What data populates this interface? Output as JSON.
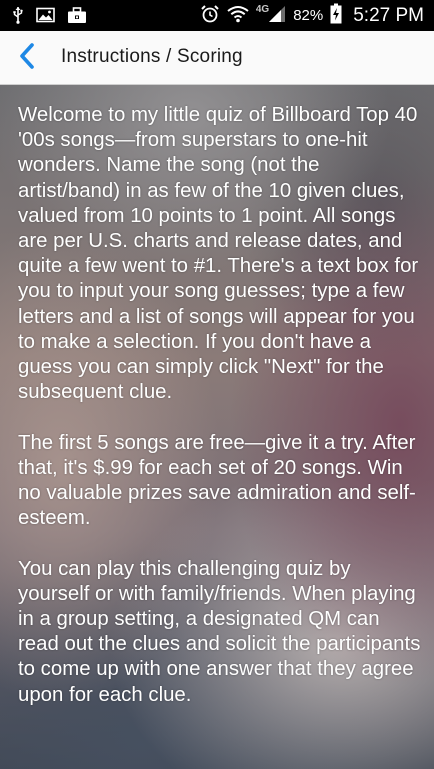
{
  "status_bar": {
    "network_label": "4G",
    "battery_percent": "82%",
    "time": "5:27 PM",
    "icons": [
      "usb-icon",
      "image-icon",
      "briefcase-icon",
      "alarm-icon",
      "wifi-icon",
      "signal-icon",
      "battery-charging-icon"
    ]
  },
  "action_bar": {
    "title": "Instructions / Scoring",
    "back_icon": "chevron-left-icon",
    "accent_color": "#1e88e5"
  },
  "instructions": {
    "paragraphs": [
      "Welcome to my little quiz of Billboard Top 40 '00s songs—from superstars to one-hit wonders. Name the song (not the artist/band) in as few of the 10 given clues, valued from 10 points to 1 point. All songs are per U.S. charts and release dates, and quite a few went to #1. There's a text box for you to input your song guesses; type a few letters and a list of songs will appear for you to make a selection. If you don't have a guess you can simply click \"Next\" for the subsequent clue.",
      "The first 5 songs are free—give it a try. After that, it's $.99 for each set of 20 songs. Win no valuable prizes save admiration and self-esteem.",
      "You can play this challenging quiz by yourself or with family/friends. When playing in a group setting, a designated QM can read out the clues and solicit the participants to come up with one answer that they agree upon for each clue."
    ]
  }
}
